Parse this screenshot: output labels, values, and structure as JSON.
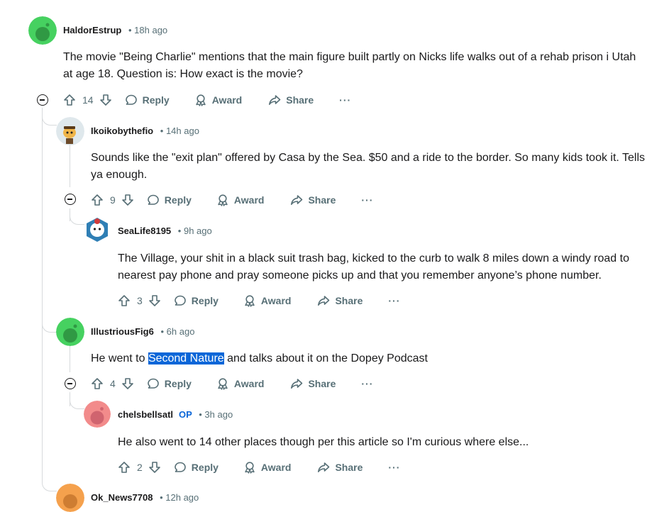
{
  "comments": [
    {
      "author": "HaldorEstrup",
      "time": "18h ago",
      "body": "The movie \"Being Charlie\" mentions that the main figure built partly on Nicks life walks out of a rehab prison i Utah at age 18. Question is: How exact is the movie?",
      "votes": "14",
      "avatar_color": "#46d160"
    },
    {
      "author": "Ikoikobythefio",
      "time": "14h ago",
      "body": "Sounds like the \"exit plan\" offered by Casa by the Sea. $50 and a ride to the border. So many kids took it. Tells ya enough.",
      "votes": "9",
      "avatar_color": "#f0b549"
    },
    {
      "author": "SeaLife8195",
      "time": "9h ago",
      "body": "The Village, your shit in a black suit trash bag, kicked to the curb to walk 8 miles down a windy road to nearest pay phone and pray someone picks up and that you remember anyone’s phone number.",
      "votes": "3",
      "avatar_color": "#d13b3b"
    },
    {
      "author": "IllustriousFig6",
      "time": "6h ago",
      "body_before": "He went to ",
      "body_highlight": "Second Nature",
      "body_after": " and talks about it on the Dopey Podcast",
      "votes": "4",
      "avatar_color": "#46d160"
    },
    {
      "author": "chelsbellsatl",
      "op_label": "OP",
      "time": "3h ago",
      "body": "He also went to 14 other places though per this article so I'm curious where else...",
      "votes": "2",
      "avatar_color": "#f28b8b"
    },
    {
      "author": "Ok_News7708",
      "time": "12h ago",
      "avatar_color": "#f5a14d"
    }
  ],
  "labels": {
    "reply": "Reply",
    "award": "Award",
    "share": "Share",
    "dot": "•",
    "more": "···"
  }
}
